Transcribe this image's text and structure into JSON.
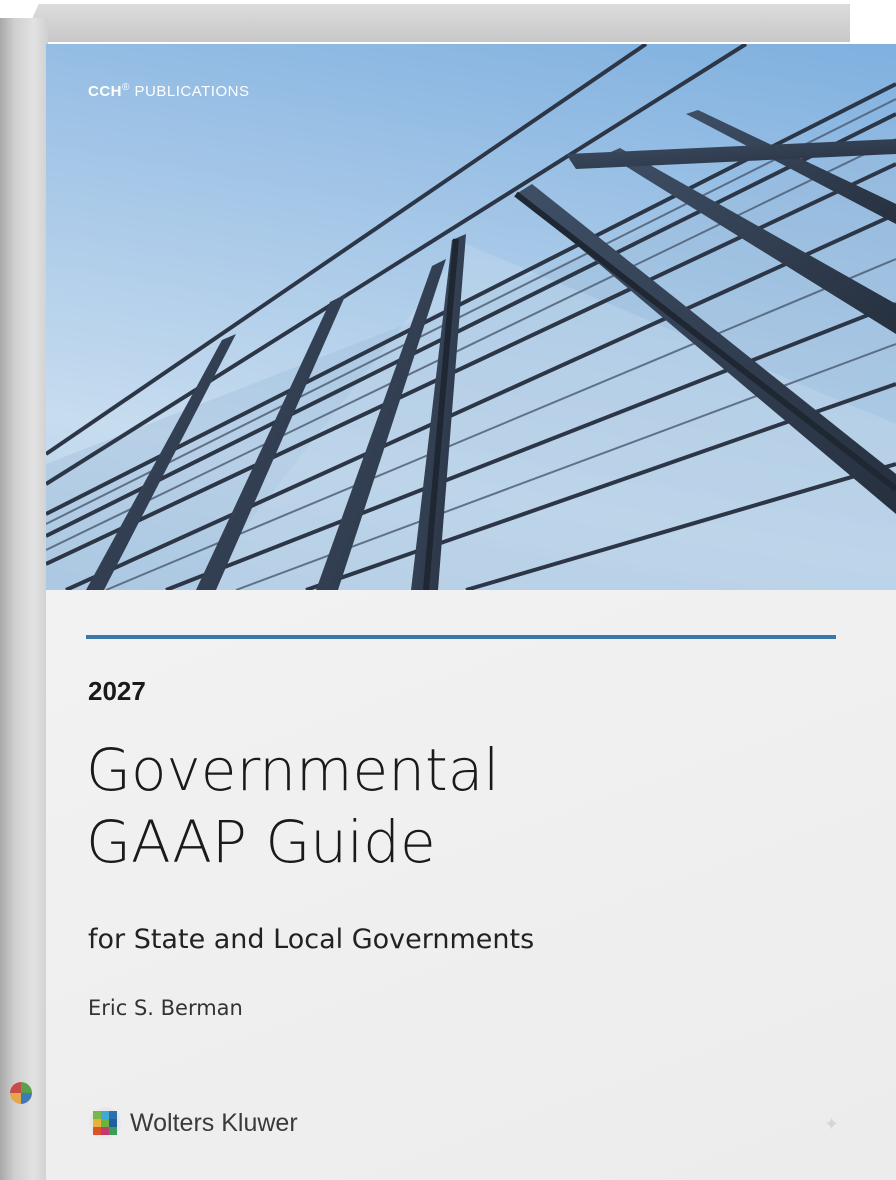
{
  "publisher": {
    "brand": "CCH",
    "mark": "®",
    "label": "PUBLICATIONS"
  },
  "edition_year": "2027",
  "title_lines": [
    "Governmental",
    "GAAP Guide"
  ],
  "subtitle": "for State and Local Governments",
  "author": "Eric S. Berman",
  "brand_name": "Wolters Kluwer",
  "colors": {
    "accent_rule": "#3b78a8",
    "sky": "#a7c8e8",
    "text": "#1a1a1a"
  },
  "icons": {
    "cover_photo": "glass-building-facade",
    "brand_logo": "wolters-kluwer-logo-icon",
    "sparkle": "sparkle-icon"
  }
}
